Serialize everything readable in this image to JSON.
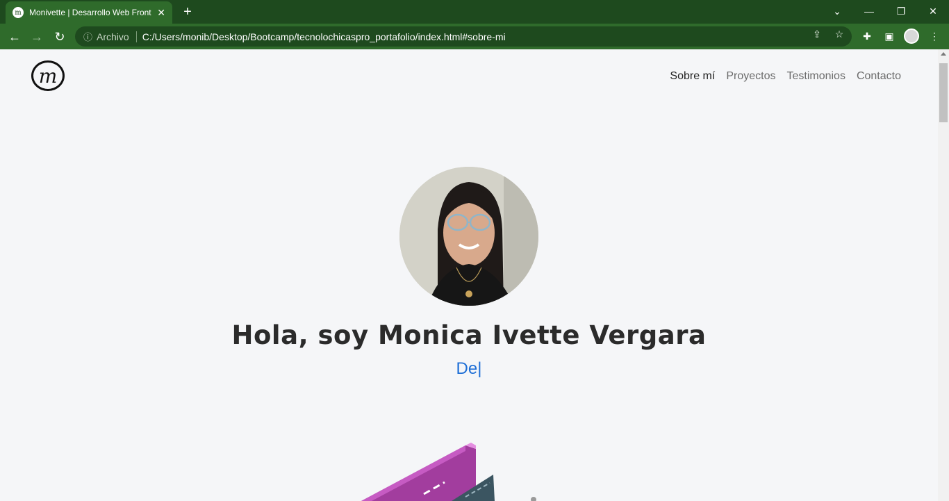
{
  "browser": {
    "tab_title": "Monivette | Desarrollo Web Front",
    "tab_close": "✕",
    "new_tab": "+",
    "omnibox": {
      "scheme_label": "Archivo",
      "url": "C:/Users/monib/Desktop/Bootcamp/tecnolochicaspro_portafolio/index.html#sobre-mi"
    },
    "window_controls": {
      "dropdown": "⌄",
      "minimize": "—",
      "maximize": "❐",
      "close": "✕"
    }
  },
  "site": {
    "logo_glyph": "m",
    "nav": [
      "Sobre mí",
      "Proyectos",
      "Testimonios",
      "Contacto"
    ],
    "active_nav": "Sobre mí",
    "heading": "Hola, soy Monica Ivette Vergara",
    "typed_text": "De|"
  },
  "colors": {
    "chrome_dark": "#1e4a1e",
    "chrome_tab": "#2f6b2b",
    "page_bg": "#f5f6f8",
    "accent_blue": "#1f6fd6",
    "illustration_pink": "#c65bc3"
  }
}
